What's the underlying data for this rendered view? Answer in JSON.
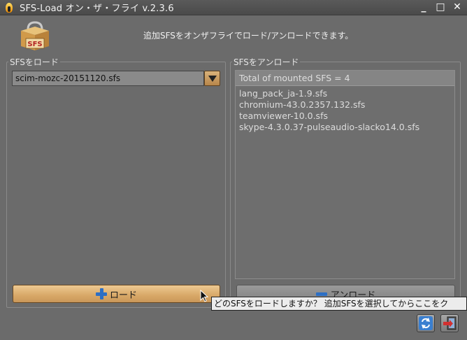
{
  "window": {
    "title": "SFS-Load オン・ザ・フライ v.2.3.6",
    "minimize": "_",
    "maximize": "□",
    "close": "✕"
  },
  "header": {
    "logo_text": "SFS",
    "message": "追加SFSをオンザフライでロード/アンロードできます。"
  },
  "load_panel": {
    "legend": "SFSをロード",
    "selected_file": "scim-mozc-20151120.sfs",
    "load_button": "ロード"
  },
  "unload_panel": {
    "legend": "SFSをアンロード",
    "list_header": "Total of mounted SFS = 4",
    "items": [
      "lang_pack_ja-1.9.sfs",
      "chromium-43.0.2357.132.sfs",
      "teamviewer-10.0.sfs",
      "skype-4.3.0.37-pulseaudio-slacko14.0.sfs"
    ],
    "unload_button": "アンロード"
  },
  "tooltip": "どのSFSをロードしますか？ 追加SFSを選択してからここをク",
  "icons": {
    "app": "flame-icon",
    "logo": "sfs-package-icon",
    "combo": "dropdown-arrow-icon",
    "load": "plus-icon",
    "unload": "minus-icon",
    "refresh": "refresh-icon",
    "exit": "exit-icon"
  },
  "colors": {
    "accent": "#d8a867",
    "icon_blue": "#2d6fc4",
    "background": "#6b6b6b"
  }
}
